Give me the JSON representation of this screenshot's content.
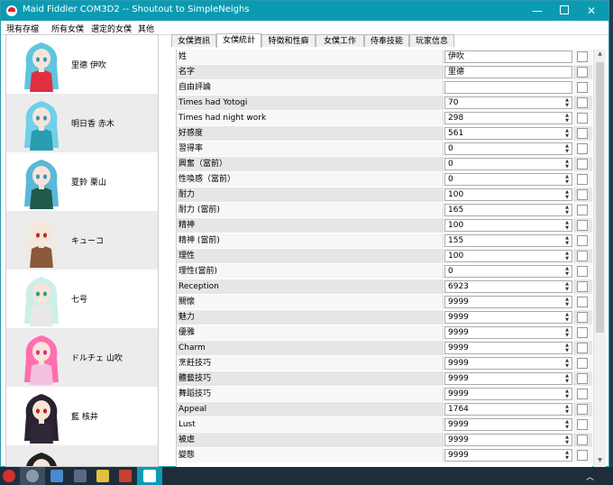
{
  "window": {
    "title": "Maid Fiddler COM3D2 -- Shoutout to SimpleNeighs",
    "minimize": "—",
    "close": "✕"
  },
  "menu": [
    "現有存檔",
    "所有女僕",
    "選定的女僕",
    "其他"
  ],
  "maids": [
    {
      "name": "里德 伊吹",
      "hair": "#5fc6e0",
      "eyes": "#3a8fc0",
      "outfit": "#e03040"
    },
    {
      "name": "明日香 赤木",
      "hair": "#6fd0e8",
      "eyes": "#3a8fc0",
      "outfit": "#2a9bb0"
    },
    {
      "name": "夏鈴 栗山",
      "hair": "#5ab8d8",
      "eyes": "#3a8fc0",
      "outfit": "#1f5a4a"
    },
    {
      "name": "キューコ",
      "hair": "#f0ebe2",
      "eyes": "#b03020",
      "outfit": "#8a5a3a"
    },
    {
      "name": "七号",
      "hair": "#cfeee8",
      "eyes": "#2aa080",
      "outfit": "#e8e8e8"
    },
    {
      "name": "ドルチェ 山吹",
      "hair": "#ff6fb0",
      "eyes": "#d03080",
      "outfit": "#f4c0e0"
    },
    {
      "name": "藍 核井",
      "hair": "#2a2230",
      "eyes": "#c02020",
      "outfit": "#302838"
    },
    {
      "name": "",
      "hair": "#202020",
      "eyes": "#202020",
      "outfit": "#202020"
    }
  ],
  "tabs": [
    "女僕資訊",
    "女僕統計",
    "特徵和性癖",
    "女僕工作",
    "侍奉技能",
    "玩家信息"
  ],
  "active_tab": 1,
  "stats": [
    {
      "name": "姓",
      "value": "伊吹",
      "spin": false
    },
    {
      "name": "名字",
      "value": "里德",
      "spin": false
    },
    {
      "name": "自由評論",
      "value": "",
      "spin": false
    },
    {
      "name": "Times had Yotogi",
      "value": "70",
      "spin": true
    },
    {
      "name": "Times had night work",
      "value": "298",
      "spin": true
    },
    {
      "name": "好感度",
      "value": "561",
      "spin": true
    },
    {
      "name": "習得率",
      "value": "0",
      "spin": true
    },
    {
      "name": "興奮（當前）",
      "value": "0",
      "spin": true
    },
    {
      "name": "性喚感（當前）",
      "value": "0",
      "spin": true
    },
    {
      "name": "耐力",
      "value": "100",
      "spin": true
    },
    {
      "name": "耐力 (當前)",
      "value": "165",
      "spin": true
    },
    {
      "name": "精神",
      "value": "100",
      "spin": true
    },
    {
      "name": "精神 (當前)",
      "value": "155",
      "spin": true
    },
    {
      "name": "理性",
      "value": "100",
      "spin": true
    },
    {
      "name": "理性(當前)",
      "value": "0",
      "spin": true
    },
    {
      "name": "Reception",
      "value": "6923",
      "spin": true
    },
    {
      "name": "關懷",
      "value": "9999",
      "spin": true
    },
    {
      "name": "魅力",
      "value": "9999",
      "spin": true
    },
    {
      "name": "優雅",
      "value": "9999",
      "spin": true
    },
    {
      "name": "Charm",
      "value": "9999",
      "spin": true
    },
    {
      "name": "烹飪技巧",
      "value": "9999",
      "spin": true
    },
    {
      "name": "體藝技巧",
      "value": "9999",
      "spin": true
    },
    {
      "name": "舞蹈技巧",
      "value": "9999",
      "spin": true
    },
    {
      "name": "Appeal",
      "value": "1764",
      "spin": true
    },
    {
      "name": "Lust",
      "value": "9999",
      "spin": true
    },
    {
      "name": "被虐",
      "value": "9999",
      "spin": true
    },
    {
      "name": "變態",
      "value": "9999",
      "spin": true
    }
  ],
  "colors": {
    "titlebar": "#0a9bb3",
    "taskbar": "#1f2d3b",
    "row_alt": "#e6e6e6"
  }
}
